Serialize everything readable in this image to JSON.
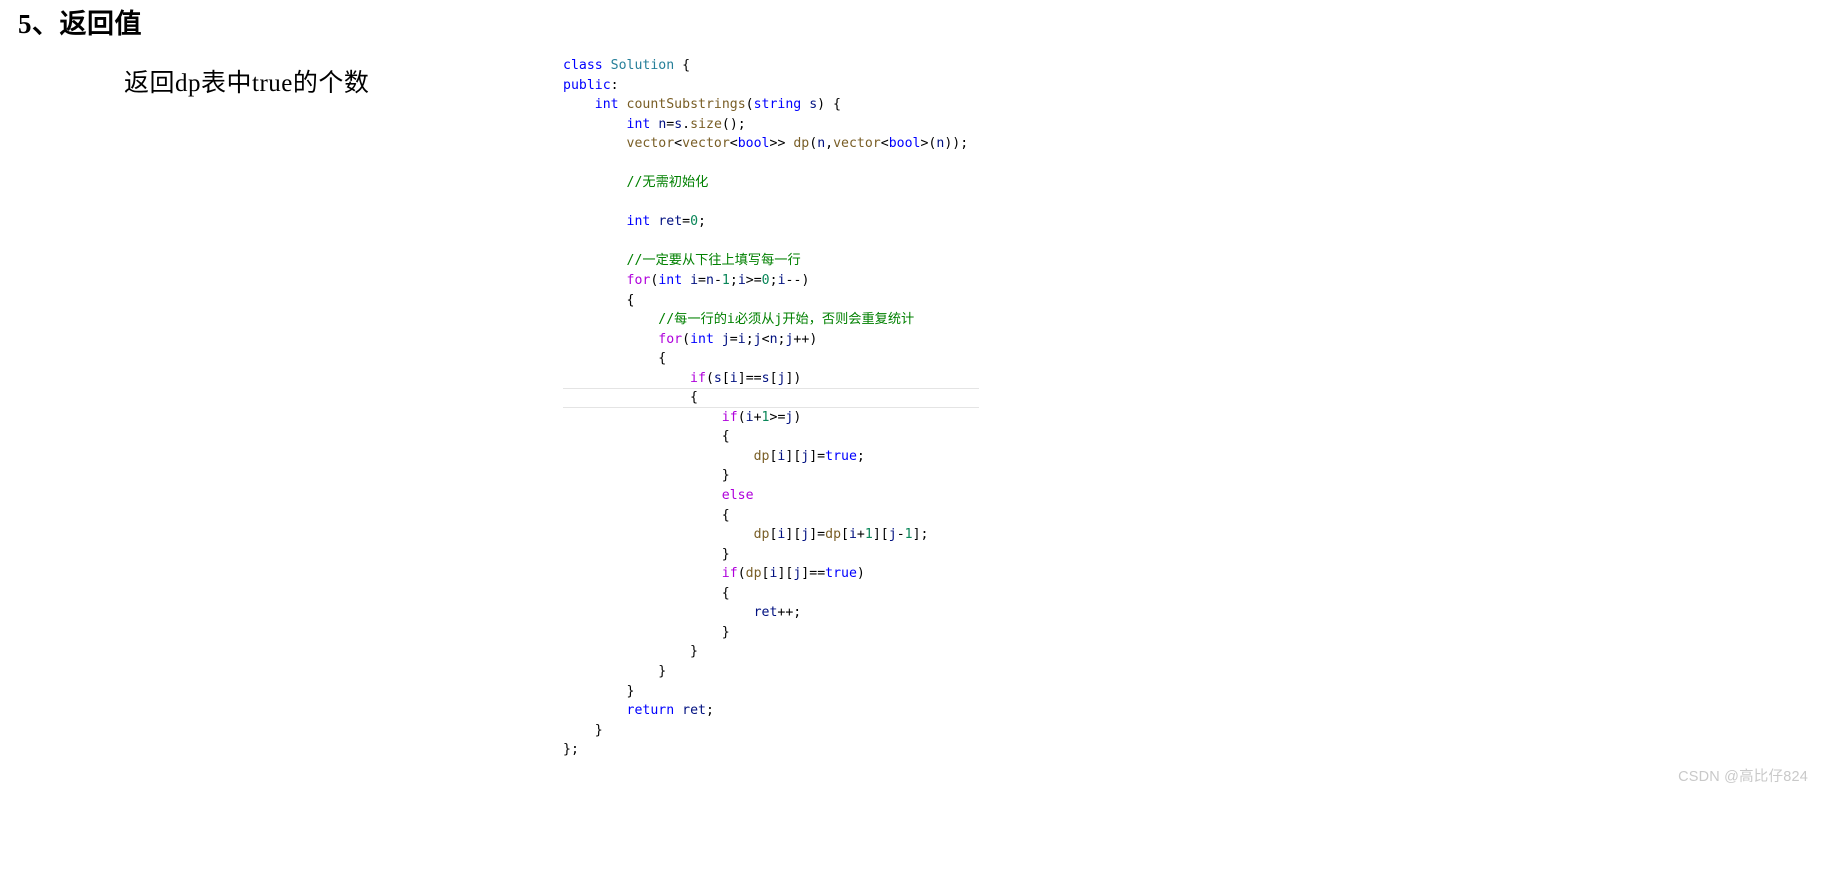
{
  "page": {
    "title": "5、返回值",
    "annotation": "返回dp表中true的个数",
    "watermark": "CSDN @高比仔824",
    "background_color": "#ffffff"
  },
  "theme": {
    "name": "vscode-light",
    "keyword_color": "#0000ff",
    "control_color": "#af00db",
    "type_color": "#267f99",
    "function_color": "#795e26",
    "number_color": "#098658",
    "variable_color": "#001080",
    "comment_color": "#008000",
    "plain_color": "#000000",
    "indent_guide_color": "#d3d3d3",
    "selected_line_border_color": "#e4e4e4"
  },
  "code": {
    "language": "cpp",
    "lines": [
      {
        "id": 1,
        "text": "class Solution {"
      },
      {
        "id": 2,
        "text": "public:"
      },
      {
        "id": 3,
        "text": "    int countSubstrings(string s) {"
      },
      {
        "id": 4,
        "text": "        int n=s.size();"
      },
      {
        "id": 5,
        "text": "        vector<vector<bool>> dp(n,vector<bool>(n));"
      },
      {
        "id": 6,
        "text": ""
      },
      {
        "id": 7,
        "text": "        //无需初始化"
      },
      {
        "id": 8,
        "text": ""
      },
      {
        "id": 9,
        "text": "        int ret=0;"
      },
      {
        "id": 10,
        "text": ""
      },
      {
        "id": 11,
        "text": "        //一定要从下往上填写每一行"
      },
      {
        "id": 12,
        "text": "        for(int i=n-1;i>=0;i--)"
      },
      {
        "id": 13,
        "text": "        {"
      },
      {
        "id": 14,
        "text": "            //每一行的i必须从j开始，否则会重复统计"
      },
      {
        "id": 15,
        "text": "            for(int j=i;j<n;j++)"
      },
      {
        "id": 16,
        "text": "            {"
      },
      {
        "id": 17,
        "text": "                if(s[i]==s[j])"
      },
      {
        "id": 18,
        "text": "                {"
      },
      {
        "id": 19,
        "text": "                    if(i+1>=j)"
      },
      {
        "id": 20,
        "text": "                    {"
      },
      {
        "id": 21,
        "text": "                        dp[i][j]=true;"
      },
      {
        "id": 22,
        "text": "                    }"
      },
      {
        "id": 23,
        "text": "                    else"
      },
      {
        "id": 24,
        "text": "                    {"
      },
      {
        "id": 25,
        "text": "                        dp[i][j]=dp[i+1][j-1];"
      },
      {
        "id": 26,
        "text": "                    }"
      },
      {
        "id": 27,
        "text": "                    if(dp[i][j]==true)"
      },
      {
        "id": 28,
        "text": "                    {"
      },
      {
        "id": 29,
        "text": "                        ret++;"
      },
      {
        "id": 30,
        "text": "                    }"
      },
      {
        "id": 31,
        "text": "                }"
      },
      {
        "id": 32,
        "text": "            }"
      },
      {
        "id": 33,
        "text": "        }"
      },
      {
        "id": 34,
        "text": "        return ret;"
      },
      {
        "id": 35,
        "text": "    }"
      },
      {
        "id": 36,
        "text": "};"
      }
    ],
    "selected_line_id": 18
  }
}
